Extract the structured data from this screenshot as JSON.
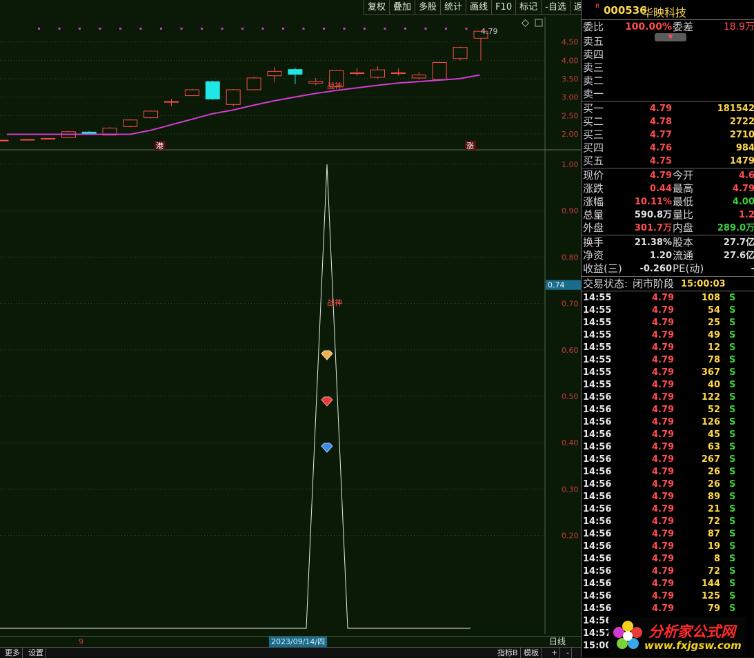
{
  "toolbar": {
    "items": [
      "复权",
      "叠加",
      "多股",
      "统计",
      "画线",
      "F10",
      "标记",
      "-自选",
      "返回"
    ]
  },
  "upper_chart": {
    "last_price_label": "4.79",
    "axis_labels": [
      "4.50",
      "4.00",
      "3.50",
      "3.00",
      "2.50",
      "2.00"
    ],
    "markers": {
      "left": "港",
      "right": "涨"
    },
    "annotation": "战神",
    "colors": {
      "up": "#ff4d4d",
      "down": "#20e6e6",
      "ma": "#d23cd2"
    }
  },
  "lower_chart": {
    "axis_labels": [
      "1.00",
      "0.90",
      "0.80",
      "0.70",
      "0.60",
      "0.50",
      "0.40",
      "0.30",
      "0.20"
    ],
    "current_value": "0.74",
    "annotation": "战神",
    "icons": [
      "diamond-gold-icon",
      "diamond-red-icon",
      "diamond-blue-icon"
    ]
  },
  "bottom_bar": {
    "left_items": [
      "更多",
      "设置"
    ],
    "date_label": "2023/09/14/四",
    "period_label": "日线",
    "tick_label": "9",
    "right_items": [
      "指标B",
      "模板",
      "+",
      "-"
    ]
  },
  "quote": {
    "flag": "R",
    "code": "000536",
    "name": "华映科技",
    "weibi_label": "委比",
    "weibi": "100.00%",
    "weicha_label": "委差",
    "weicha": "18.9万",
    "sell": [
      {
        "label": "卖五"
      },
      {
        "label": "卖四"
      },
      {
        "label": "卖三"
      },
      {
        "label": "卖二"
      },
      {
        "label": "卖一"
      }
    ],
    "buy": [
      {
        "label": "买一",
        "price": "4.79",
        "vol": "181542"
      },
      {
        "label": "买二",
        "price": "4.78",
        "vol": "2722"
      },
      {
        "label": "买三",
        "price": "4.77",
        "vol": "2710"
      },
      {
        "label": "买四",
        "price": "4.76",
        "vol": "984"
      },
      {
        "label": "买五",
        "price": "4.75",
        "vol": "1479"
      }
    ],
    "stats": [
      {
        "l1": "现价",
        "v1": "4.79",
        "c1": "red",
        "l2": "今开",
        "v2": "4.6",
        "c2": "red"
      },
      {
        "l1": "涨跌",
        "v1": "0.44",
        "c1": "red",
        "l2": "最高",
        "v2": "4.79",
        "c2": "red"
      },
      {
        "l1": "涨幅",
        "v1": "10.11%",
        "c1": "red",
        "l2": "最低",
        "v2": "4.00",
        "c2": "green"
      },
      {
        "l1": "总量",
        "v1": "590.8万",
        "c1": "white",
        "l2": "量比",
        "v2": "1.2",
        "c2": "red"
      },
      {
        "l1": "外盘",
        "v1": "301.7万",
        "c1": "red",
        "l2": "内盘",
        "v2": "289.0万",
        "c2": "green"
      }
    ],
    "stats2": [
      {
        "l1": "换手",
        "v1": "21.38%",
        "c1": "white",
        "l2": "股本",
        "v2": "27.7亿",
        "c2": "white"
      },
      {
        "l1": "净资",
        "v1": "1.20",
        "c1": "white",
        "l2": "流通",
        "v2": "27.6亿",
        "c2": "white"
      },
      {
        "l1": "收益(三)",
        "v1": "-0.260",
        "c1": "white",
        "l2": "PE(动)",
        "v2": "-",
        "c2": "white"
      }
    ],
    "status_label": "交易状态:",
    "status_value": "闭市阶段",
    "status_time": "15:00:03"
  },
  "ticks": [
    {
      "t": "14:55",
      "p": "4.79",
      "v": "108",
      "s": "S"
    },
    {
      "t": "14:55",
      "p": "4.79",
      "v": "54",
      "s": "S"
    },
    {
      "t": "14:55",
      "p": "4.79",
      "v": "25",
      "s": "S"
    },
    {
      "t": "14:55",
      "p": "4.79",
      "v": "49",
      "s": "S"
    },
    {
      "t": "14:55",
      "p": "4.79",
      "v": "12",
      "s": "S"
    },
    {
      "t": "14:55",
      "p": "4.79",
      "v": "78",
      "s": "S"
    },
    {
      "t": "14:55",
      "p": "4.79",
      "v": "367",
      "s": "S"
    },
    {
      "t": "14:55",
      "p": "4.79",
      "v": "40",
      "s": "S"
    },
    {
      "t": "14:56",
      "p": "4.79",
      "v": "122",
      "s": "S"
    },
    {
      "t": "14:56",
      "p": "4.79",
      "v": "52",
      "s": "S"
    },
    {
      "t": "14:56",
      "p": "4.79",
      "v": "126",
      "s": "S"
    },
    {
      "t": "14:56",
      "p": "4.79",
      "v": "45",
      "s": "S"
    },
    {
      "t": "14:56",
      "p": "4.79",
      "v": "63",
      "s": "S"
    },
    {
      "t": "14:56",
      "p": "4.79",
      "v": "267",
      "s": "S"
    },
    {
      "t": "14:56",
      "p": "4.79",
      "v": "26",
      "s": "S"
    },
    {
      "t": "14:56",
      "p": "4.79",
      "v": "26",
      "s": "S"
    },
    {
      "t": "14:56",
      "p": "4.79",
      "v": "89",
      "s": "S"
    },
    {
      "t": "14:56",
      "p": "4.79",
      "v": "21",
      "s": "S"
    },
    {
      "t": "14:56",
      "p": "4.79",
      "v": "72",
      "s": "S"
    },
    {
      "t": "14:56",
      "p": "4.79",
      "v": "87",
      "s": "S"
    },
    {
      "t": "14:56",
      "p": "4.79",
      "v": "19",
      "s": "S"
    },
    {
      "t": "14:56",
      "p": "4.79",
      "v": "8",
      "s": "S"
    },
    {
      "t": "14:56",
      "p": "4.79",
      "v": "72",
      "s": "S"
    },
    {
      "t": "14:56",
      "p": "4.79",
      "v": "144",
      "s": "S"
    },
    {
      "t": "14:56",
      "p": "4.79",
      "v": "125",
      "s": "S"
    },
    {
      "t": "14:56",
      "p": "4.79",
      "v": "79",
      "s": "S"
    },
    {
      "t": "14:56",
      "p": "",
      "v": "",
      "s": ""
    },
    {
      "t": "14:57",
      "p": "",
      "v": "",
      "s": ""
    },
    {
      "t": "15:00",
      "p": "",
      "v": "",
      "s": ""
    }
  ],
  "watermark": {
    "title": "分析家公式网",
    "url": "www.fxjgsw.com"
  },
  "candles": [
    {
      "o": 1.83,
      "c": 1.83,
      "h": 1.84,
      "l": 1.82
    },
    {
      "o": 1.84,
      "c": 1.85,
      "h": 1.86,
      "l": 1.83
    },
    {
      "o": 1.86,
      "c": 1.88,
      "h": 1.89,
      "l": 1.85
    },
    {
      "o": 1.9,
      "c": 2.06,
      "h": 2.08,
      "l": 1.89
    },
    {
      "o": 2.05,
      "c": 2.0,
      "h": 2.08,
      "l": 1.98
    },
    {
      "o": 1.97,
      "c": 2.16,
      "h": 2.18,
      "l": 1.96
    },
    {
      "o": 2.2,
      "c": 2.38,
      "h": 2.4,
      "l": 2.18
    },
    {
      "o": 2.44,
      "c": 2.62,
      "h": 2.64,
      "l": 2.42
    },
    {
      "o": 2.86,
      "c": 2.88,
      "h": 2.95,
      "l": 2.75
    },
    {
      "o": 3.04,
      "c": 3.2,
      "h": 3.22,
      "l": 3.03
    },
    {
      "o": 3.42,
      "c": 2.95,
      "h": 3.45,
      "l": 2.92
    },
    {
      "o": 2.8,
      "c": 3.2,
      "h": 3.22,
      "l": 2.75
    },
    {
      "o": 3.2,
      "c": 3.52,
      "h": 3.55,
      "l": 3.18
    },
    {
      "o": 3.58,
      "c": 3.7,
      "h": 3.82,
      "l": 3.4
    },
    {
      "o": 3.75,
      "c": 3.62,
      "h": 3.8,
      "l": 3.35
    },
    {
      "o": 3.38,
      "c": 3.42,
      "h": 3.52,
      "l": 3.32
    },
    {
      "o": 3.28,
      "c": 3.72,
      "h": 3.74,
      "l": 3.25
    },
    {
      "o": 3.64,
      "c": 3.66,
      "h": 3.78,
      "l": 3.58
    },
    {
      "o": 3.54,
      "c": 3.74,
      "h": 3.84,
      "l": 3.5
    },
    {
      "o": 3.64,
      "c": 3.66,
      "h": 3.78,
      "l": 3.58
    },
    {
      "o": 3.52,
      "c": 3.6,
      "h": 3.68,
      "l": 3.48
    },
    {
      "o": 3.48,
      "c": 3.94,
      "h": 3.96,
      "l": 3.46
    },
    {
      "o": 4.05,
      "c": 4.35,
      "h": 4.37,
      "l": 4.0
    },
    {
      "o": 4.6,
      "c": 4.79,
      "h": 4.79,
      "l": 4.0
    }
  ],
  "ma": [
    1.99,
    1.99,
    1.99,
    1.99,
    1.99,
    1.99,
    1.99,
    2.1,
    2.25,
    2.4,
    2.55,
    2.65,
    2.78,
    2.9,
    3.0,
    3.1,
    3.18,
    3.25,
    3.32,
    3.38,
    3.42,
    3.46,
    3.5,
    3.6
  ],
  "oscillator": {
    "baseline": 0.0,
    "peak": 1.0,
    "peak_index": 15
  }
}
